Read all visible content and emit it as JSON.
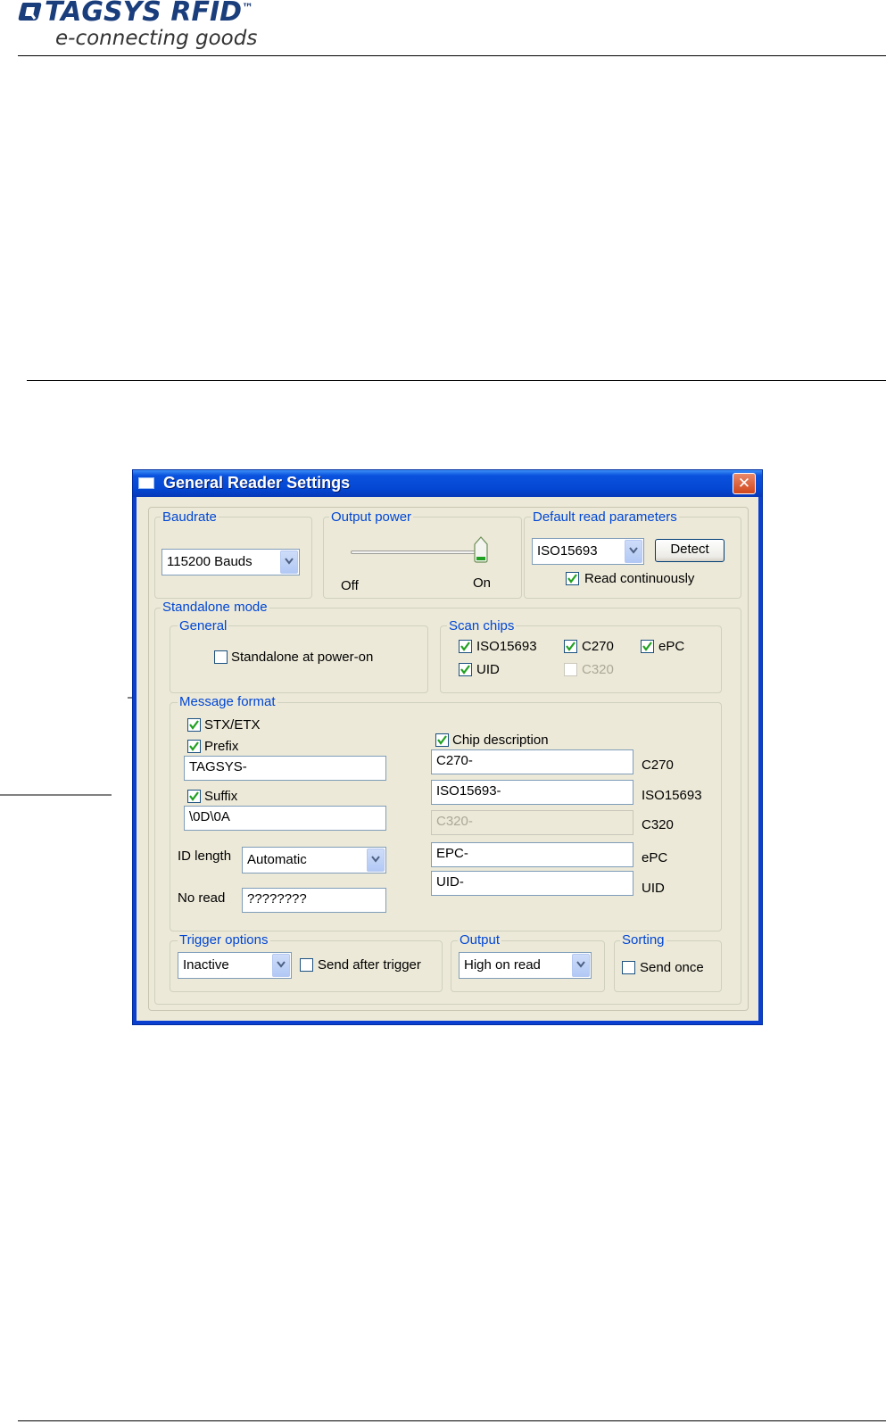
{
  "header": {
    "logo_text": "TAGSYS RFID",
    "logo_tm": "™",
    "tagline": "e-connecting goods"
  },
  "dialog": {
    "title": "General Reader Settings",
    "close_glyph": "✕",
    "baudrate": {
      "group_label": "Baudrate",
      "value": "115200 Bauds"
    },
    "output_power": {
      "group_label": "Output power",
      "min_label": "Off",
      "max_label": "On",
      "level": 1.0
    },
    "default_read": {
      "group_label": "Default read parameters",
      "protocol": "ISO15693",
      "detect_label": "Detect",
      "read_continuously_label": "Read continuously",
      "read_continuously_checked": true
    },
    "standalone": {
      "group_label": "Standalone mode",
      "general": {
        "group_label": "General",
        "power_on_label": "Standalone at power-on",
        "power_on_checked": false
      },
      "scan_chips": {
        "group_label": "Scan chips",
        "items": [
          {
            "label": "ISO15693",
            "checked": true,
            "enabled": true
          },
          {
            "label": "C270",
            "checked": true,
            "enabled": true
          },
          {
            "label": "ePC",
            "checked": true,
            "enabled": true
          },
          {
            "label": "UID",
            "checked": true,
            "enabled": true
          },
          {
            "label": "C320",
            "checked": false,
            "enabled": false
          }
        ]
      },
      "message_format": {
        "group_label": "Message format",
        "stx_etx_label": "STX/ETX",
        "prefix_label": "Prefix",
        "prefix_value": "TAGSYS-",
        "suffix_label": "Suffix",
        "suffix_value": "\\0D\\0A",
        "id_length_label": "ID length",
        "id_length_value": "Automatic",
        "no_read_label": "No read",
        "no_read_value": "????????",
        "chip_description_label": "Chip description",
        "chip_fields": [
          {
            "value": "C270-",
            "label": "C270",
            "enabled": true
          },
          {
            "value": "ISO15693-",
            "label": "ISO15693",
            "enabled": true
          },
          {
            "value": "C320-",
            "label": "C320",
            "enabled": false
          },
          {
            "value": "EPC-",
            "label": "ePC",
            "enabled": true
          },
          {
            "value": "UID-",
            "label": "UID",
            "enabled": true
          }
        ]
      },
      "trigger": {
        "group_label": "Trigger options",
        "value": "Inactive",
        "send_after_label": "Send after trigger"
      },
      "output": {
        "group_label": "Output",
        "value": "High on read"
      },
      "sorting": {
        "group_label": "Sorting",
        "send_once_label": "Send once"
      }
    }
  }
}
